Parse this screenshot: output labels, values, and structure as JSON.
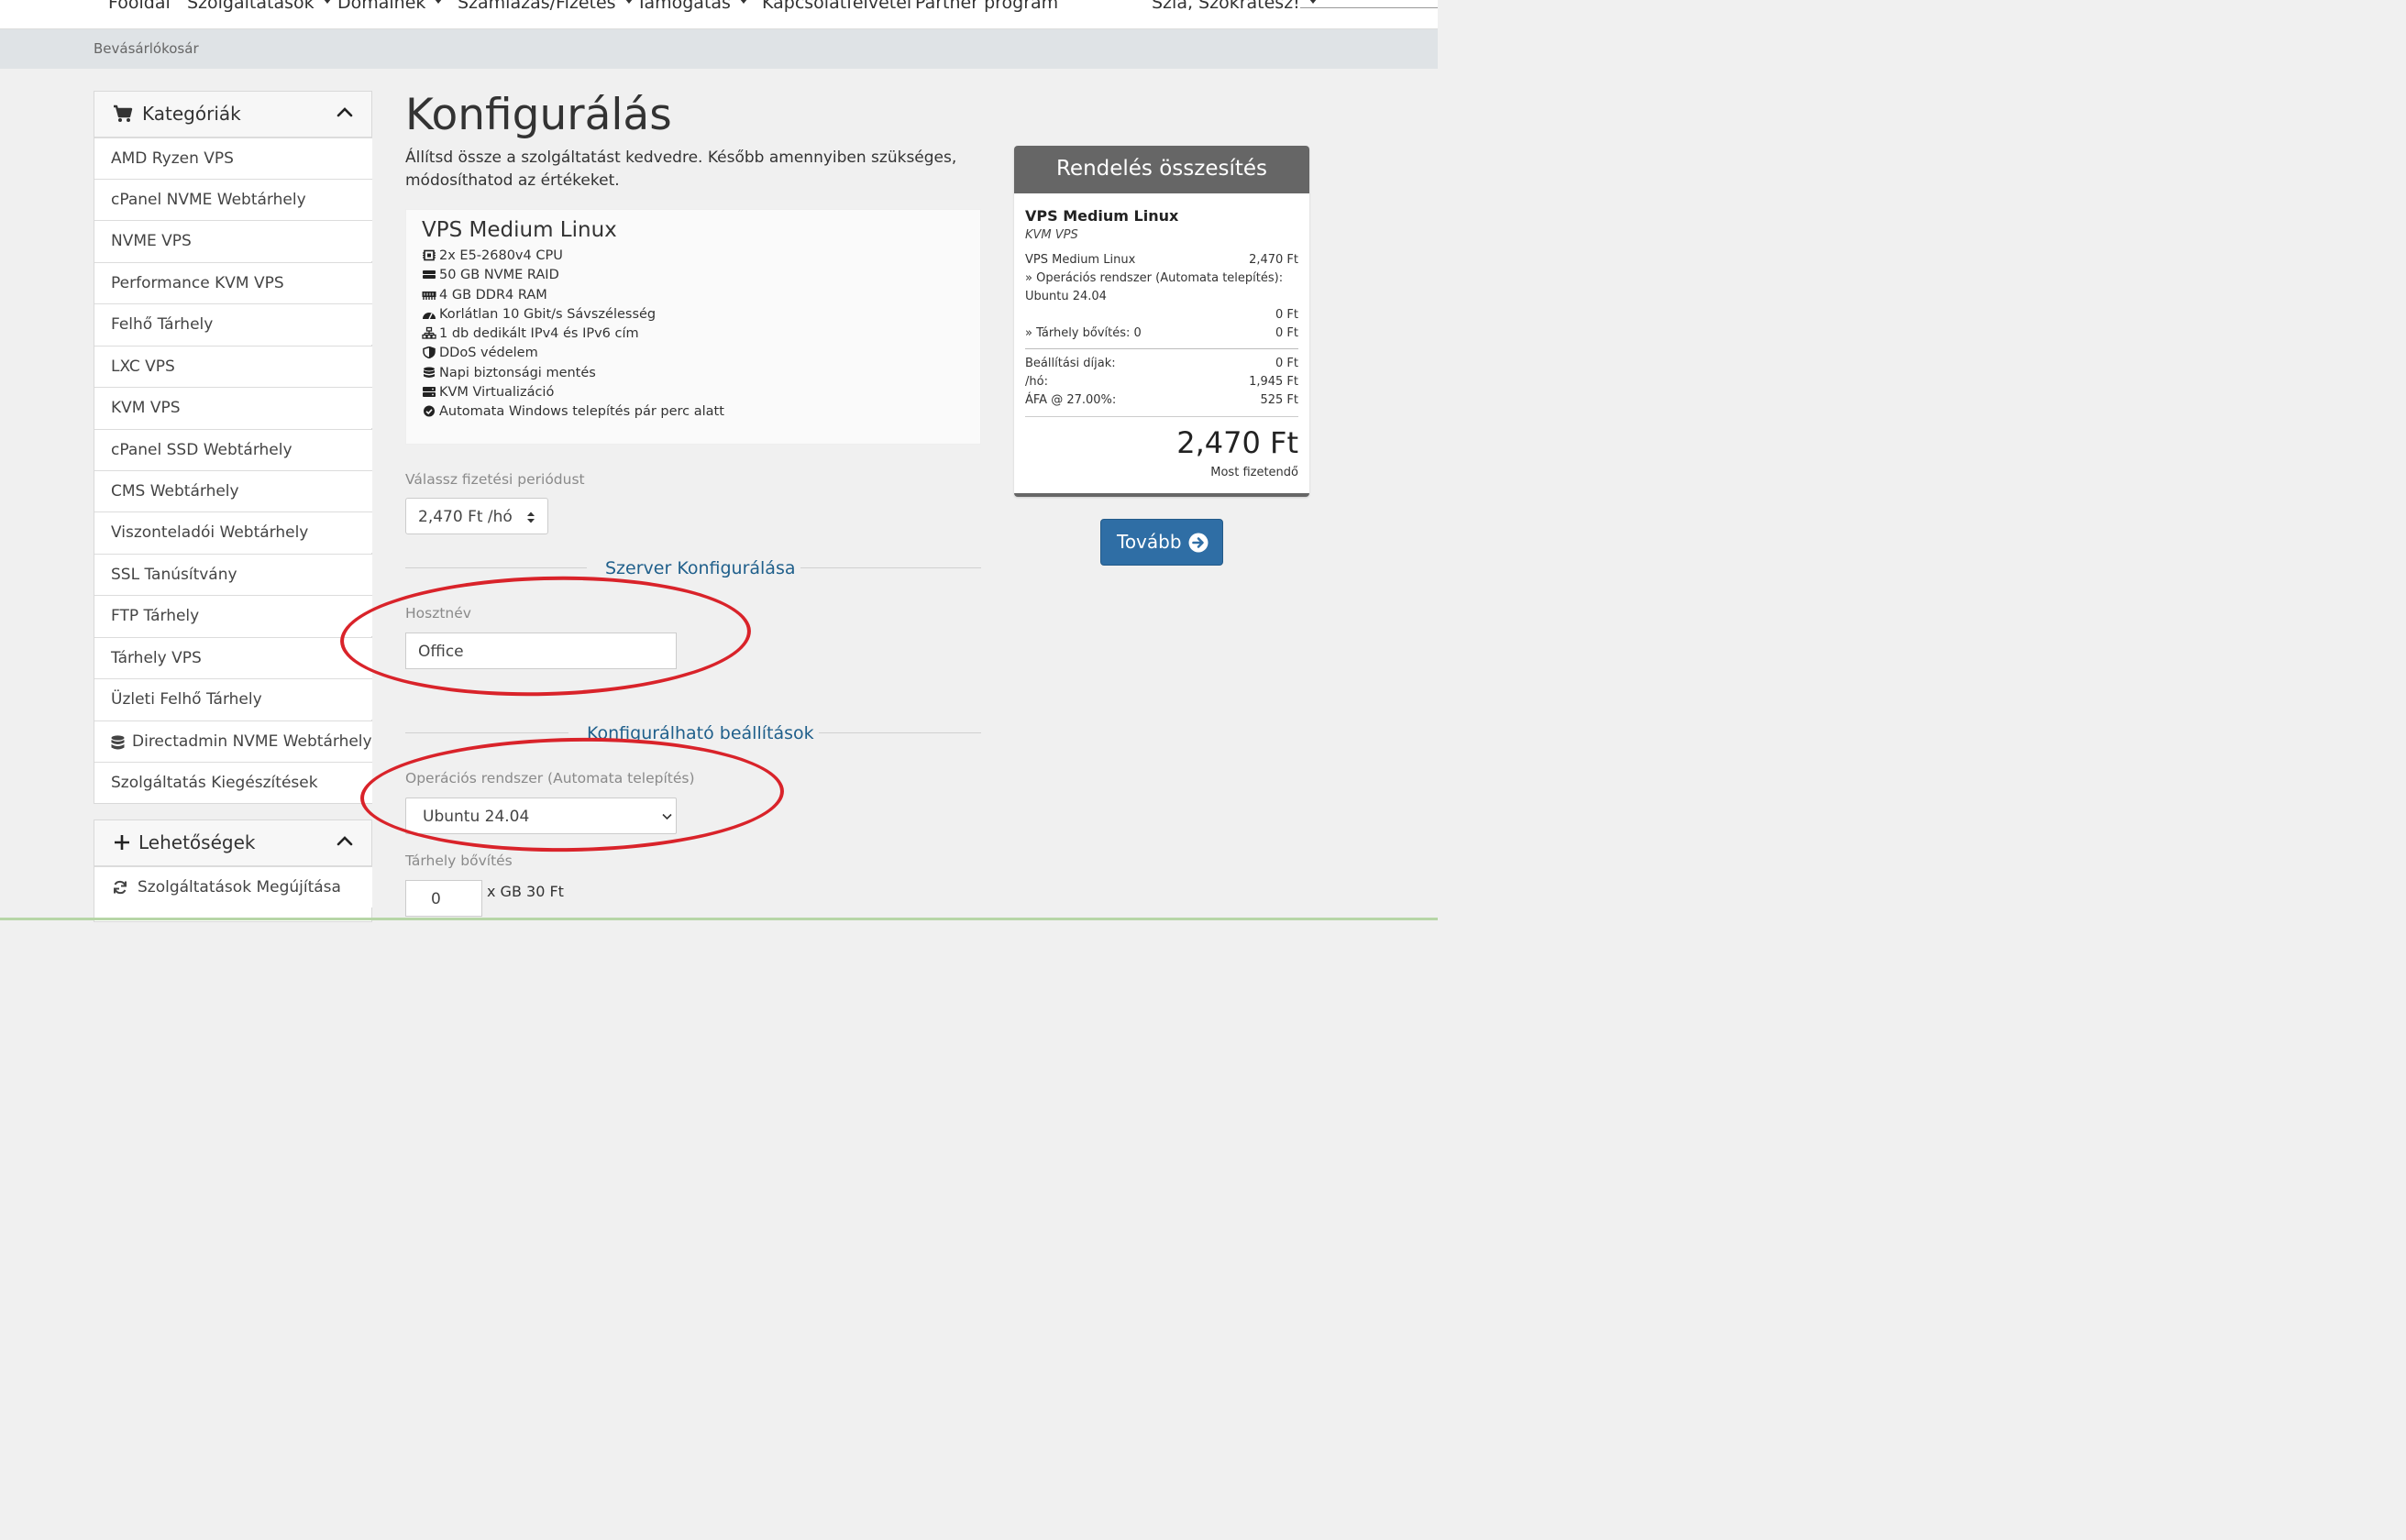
{
  "topnav": {
    "items": [
      {
        "label": "Főoldal",
        "caret": false
      },
      {
        "label": "Szolgáltatások",
        "caret": true
      },
      {
        "label": "Domainek",
        "caret": true
      },
      {
        "label": "Számlázás/Fizetés",
        "caret": true
      },
      {
        "label": "Támogatás",
        "caret": true
      },
      {
        "label": "Kapcsolatfelvétel",
        "caret": false
      },
      {
        "label": "Partner program",
        "caret": false
      }
    ],
    "user_label": "Szia, Szokratesz!"
  },
  "breadcrumb": {
    "current": "Bevásárlókosár"
  },
  "sidebar": {
    "categories": {
      "title": "Kategóriák",
      "icon": "cart-icon",
      "items": [
        {
          "label": "AMD Ryzen VPS"
        },
        {
          "label": "cPanel NVME Webtárhely"
        },
        {
          "label": "NVME VPS"
        },
        {
          "label": "Performance KVM VPS"
        },
        {
          "label": "Felhő Tárhely"
        },
        {
          "label": "LXC VPS"
        },
        {
          "label": "KVM VPS"
        },
        {
          "label": "cPanel SSD Webtárhely"
        },
        {
          "label": "CMS Webtárhely"
        },
        {
          "label": "Viszonteladói Webtárhely"
        },
        {
          "label": "SSL Tanúsítvány"
        },
        {
          "label": "FTP Tárhely"
        },
        {
          "label": "Tárhely VPS"
        },
        {
          "label": "Üzleti Felhő Tárhely"
        },
        {
          "label": "Directadmin NVME Webtárhely",
          "icon": "database-icon"
        },
        {
          "label": "Szolgáltatás Kiegészítések"
        }
      ]
    },
    "options": {
      "title": "Lehetőségek",
      "icon": "plus-icon",
      "items": [
        {
          "label": "Szolgáltatások Megújítása",
          "icon": "refresh-icon"
        }
      ]
    }
  },
  "main": {
    "title": "Konfigurálás",
    "intro": "Állítsd össze a szolgáltatást kedvedre. Később amennyiben szükséges, módosíthatod az értékeket.",
    "product": {
      "name": "VPS Medium Linux",
      "features": [
        {
          "icon": "cpu-icon",
          "text": "2x E5-2680v4 CPU"
        },
        {
          "icon": "hdd-icon",
          "text": "50 GB NVME RAID"
        },
        {
          "icon": "memory-icon",
          "text": "4 GB DDR4 RAM"
        },
        {
          "icon": "speed-icon",
          "text": "Korlátlan 10 Gbit/s Sávszélesség"
        },
        {
          "icon": "network-icon",
          "text": "1 db dedikált IPv4 és IPv6 cím"
        },
        {
          "icon": "shield-icon",
          "text": "DDoS védelem"
        },
        {
          "icon": "database-icon",
          "text": "Napi biztonsági mentés"
        },
        {
          "icon": "server-icon",
          "text": "KVM Virtualizáció"
        },
        {
          "icon": "check-circle-icon",
          "text": "Automata Windows telepítés pár perc alatt"
        }
      ]
    },
    "billing": {
      "label": "Válassz fizetési periódust",
      "value": "2,470 Ft /hó"
    },
    "server_config": {
      "title": "Szerver Konfigurálása",
      "hostname_label": "Hosztnév",
      "hostname_value": "Office"
    },
    "configurable": {
      "title": "Konfigurálható beállítások",
      "os_label": "Operációs rendszer (Automata telepítés)",
      "os_value": "Ubuntu 24.04",
      "storage_label": "Tárhely bővítés",
      "storage_value": "0",
      "storage_unit": "x GB 30 Ft"
    }
  },
  "summary": {
    "title": "Rendelés összesítés",
    "product_name": "VPS Medium Linux",
    "product_group": "KVM VPS",
    "lines": {
      "product_label": "VPS Medium Linux",
      "product_price": "2,470 Ft",
      "os_label": "» Operációs rendszer (Automata telepítés):",
      "os_value": "Ubuntu 24.04",
      "os_price": "0 Ft",
      "storage_label": "» Tárhely bővítés: 0",
      "storage_price": "0 Ft"
    },
    "fees": {
      "setup_label": "Beállítási díjak:",
      "setup_value": "0 Ft",
      "monthly_label": "/hó:",
      "monthly_value": "1,945 Ft",
      "vat_label": "ÁFA @ 27.00%:",
      "vat_value": "525 Ft"
    },
    "total": "2,470 Ft",
    "total_label": "Most fizetendő"
  },
  "continue_button": {
    "label": "Tovább",
    "icon": "arrow-right-circle-icon"
  },
  "colors": {
    "accent": "#2f6ea5",
    "section_title": "#1f5f8b",
    "summary_header": "#666666",
    "annotation": "#d9232a"
  }
}
